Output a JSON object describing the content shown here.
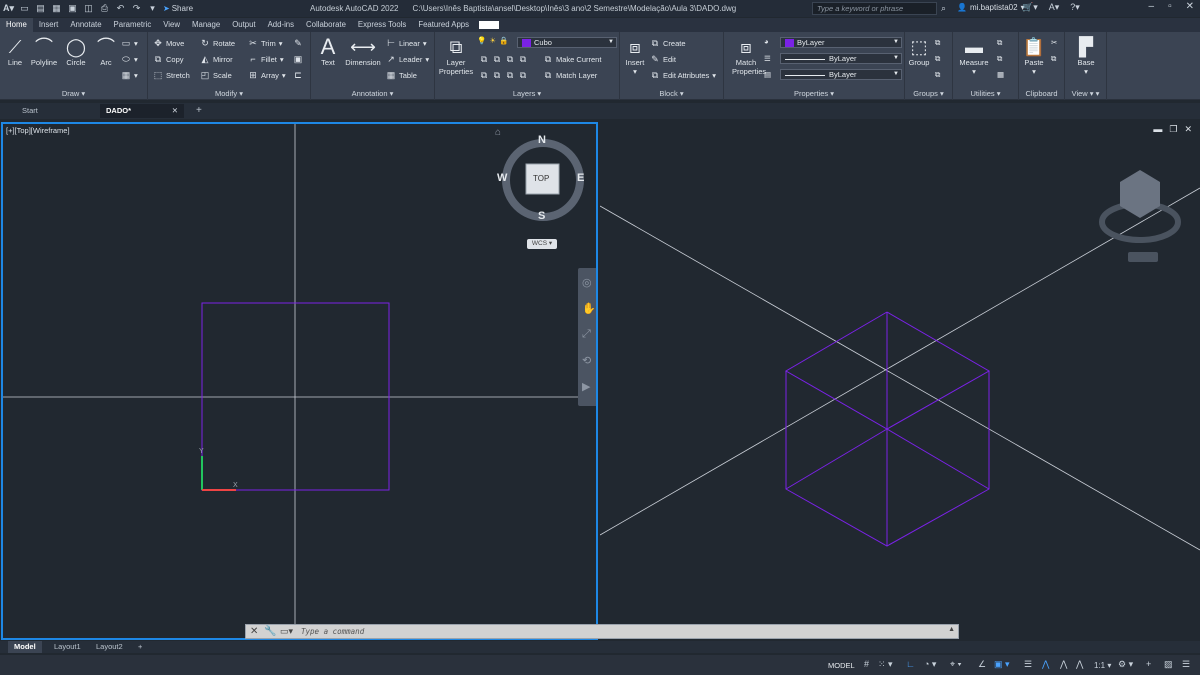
{
  "titlebar": {
    "app": "Autodesk AutoCAD 2022",
    "path": "C:\\Users\\Inês Baptista\\ansel\\Desktop\\Inês\\3 ano\\2 Semestre\\Modelação\\Aula 3\\DADO.dwg",
    "share_label": "Share",
    "search_placeholder": "Type a keyword or phrase",
    "username": "mi.baptista02"
  },
  "ribbon_tabs": [
    "Home",
    "Insert",
    "Annotate",
    "Parametric",
    "View",
    "Manage",
    "Output",
    "Add-ins",
    "Collaborate",
    "Express Tools",
    "Featured Apps"
  ],
  "ribbon": {
    "draw": {
      "title": "Draw",
      "line": "Line",
      "polyline": "Polyline",
      "circle": "Circle",
      "arc": "Arc"
    },
    "modify": {
      "title": "Modify",
      "move": "Move",
      "rotate": "Rotate",
      "trim": "Trim",
      "copy": "Copy",
      "mirror": "Mirror",
      "fillet": "Fillet",
      "stretch": "Stretch",
      "scale": "Scale",
      "array": "Array"
    },
    "annotation": {
      "title": "Annotation",
      "text": "Text",
      "dimension": "Dimension",
      "linear": "Linear",
      "leader": "Leader",
      "table": "Table"
    },
    "layers": {
      "title": "Layers",
      "layer_properties": "Layer Properties",
      "current_layer": "Cubo",
      "make_current": "Make Current",
      "match_layer": "Match Layer",
      "layer_color": "#7a22e6"
    },
    "block": {
      "title": "Block",
      "insert": "Insert",
      "create": "Create",
      "edit": "Edit",
      "edit_attributes": "Edit Attributes"
    },
    "properties": {
      "title": "Properties",
      "match": "Match Properties",
      "color": "ByLayer",
      "linetype": "ByLayer",
      "lineweight": "ByLayer"
    },
    "groups": {
      "title": "Groups",
      "group": "Group"
    },
    "utilities": {
      "title": "Utilities",
      "measure": "Measure"
    },
    "clipboard": {
      "title": "Clipboard",
      "paste": "Paste"
    },
    "view": {
      "title": "View",
      "base": "Base"
    }
  },
  "file_tabs": [
    "Start",
    "DADO*"
  ],
  "viewport_left": {
    "label": "[+][Top][Wireframe]",
    "viewcube": {
      "north": "N",
      "south": "S",
      "east": "E",
      "west": "W",
      "face": "TOP",
      "ucs": "WCS"
    }
  },
  "command_line": {
    "placeholder": "Type a command"
  },
  "layout_tabs": [
    "Model",
    "Layout1",
    "Layout2"
  ],
  "statusbar": {
    "model": "MODEL",
    "scale": "1:1"
  },
  "colors": {
    "accent": "#1e88e5",
    "geometry": "#7a22e6",
    "background": "#212830"
  }
}
